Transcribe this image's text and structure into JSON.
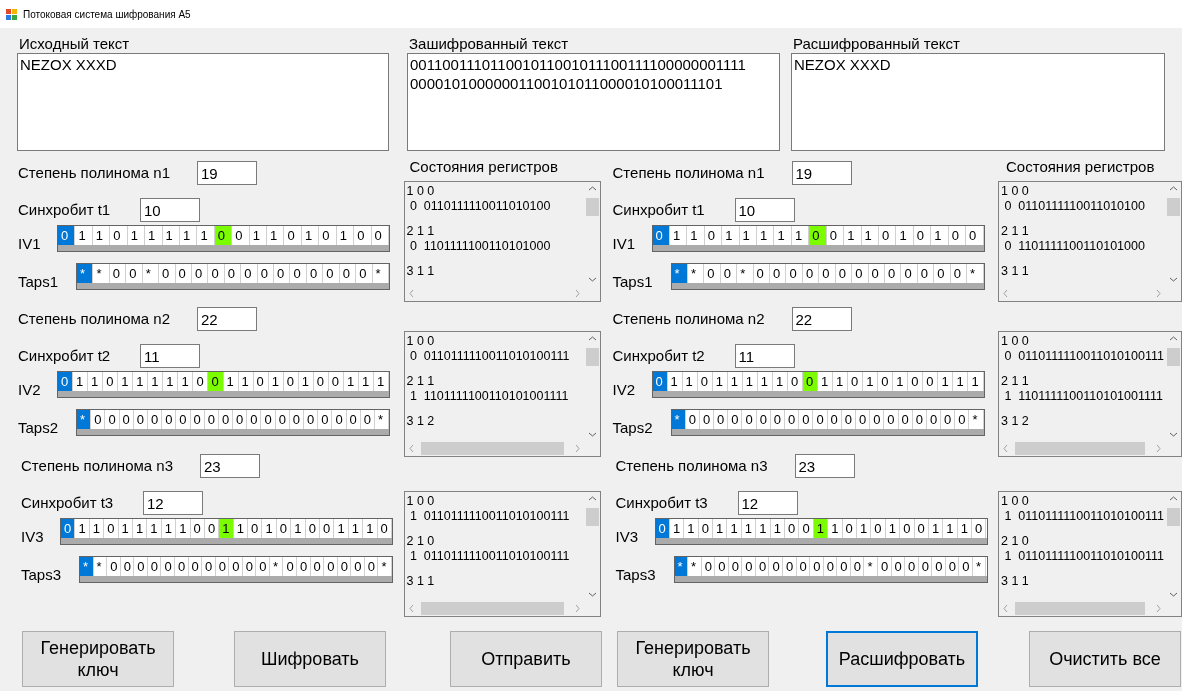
{
  "window": {
    "title": "Потоковая система шифрования А5"
  },
  "texts": [
    {
      "label": "Исходный текст",
      "lines": [
        "NEZOX XXXD"
      ]
    },
    {
      "label": "Зашифрованный текст",
      "lines": [
        "001100111011001011001011100111100000001111",
        "00001010000001100101011000010100011101"
      ]
    },
    {
      "label": "Расшифрованный текст",
      "lines": [
        "NEZOX XXXD"
      ]
    }
  ],
  "panels": [
    {
      "states_title": "Состояния регистров",
      "registers": [
        {
          "degree_label": "Степень полинома n1",
          "degree": "19",
          "sync_label": "Синхробит t1",
          "sync": "10",
          "iv": {
            "label": "IV1",
            "cells": [
              {
                "text": "0",
                "selected": true,
                "highlighted": false
              },
              {
                "text": "1",
                "selected": false,
                "highlighted": false
              },
              {
                "text": "1",
                "selected": false,
                "highlighted": false
              },
              {
                "text": "0",
                "selected": false,
                "highlighted": false
              },
              {
                "text": "1",
                "selected": false,
                "highlighted": false
              },
              {
                "text": "1",
                "selected": false,
                "highlighted": false
              },
              {
                "text": "1",
                "selected": false,
                "highlighted": false
              },
              {
                "text": "1",
                "selected": false,
                "highlighted": false
              },
              {
                "text": "1",
                "selected": false,
                "highlighted": false
              },
              {
                "text": "0",
                "selected": false,
                "highlighted": true
              },
              {
                "text": "0",
                "selected": false,
                "highlighted": false
              },
              {
                "text": "1",
                "selected": false,
                "highlighted": false
              },
              {
                "text": "1",
                "selected": false,
                "highlighted": false
              },
              {
                "text": "0",
                "selected": false,
                "highlighted": false
              },
              {
                "text": "1",
                "selected": false,
                "highlighted": false
              },
              {
                "text": "0",
                "selected": false,
                "highlighted": false
              },
              {
                "text": "1",
                "selected": false,
                "highlighted": false
              },
              {
                "text": "0",
                "selected": false,
                "highlighted": false
              },
              {
                "text": "0",
                "selected": false,
                "highlighted": false
              }
            ]
          },
          "taps": {
            "label": "Taps1",
            "cells": [
              {
                "text": "*",
                "selected": true,
                "highlighted": false
              },
              {
                "text": "*",
                "selected": false,
                "highlighted": false
              },
              {
                "text": "0",
                "selected": false,
                "highlighted": false
              },
              {
                "text": "0",
                "selected": false,
                "highlighted": false
              },
              {
                "text": "*",
                "selected": false,
                "highlighted": false
              },
              {
                "text": "0",
                "selected": false,
                "highlighted": false
              },
              {
                "text": "0",
                "selected": false,
                "highlighted": false
              },
              {
                "text": "0",
                "selected": false,
                "highlighted": false
              },
              {
                "text": "0",
                "selected": false,
                "highlighted": false
              },
              {
                "text": "0",
                "selected": false,
                "highlighted": false
              },
              {
                "text": "0",
                "selected": false,
                "highlighted": false
              },
              {
                "text": "0",
                "selected": false,
                "highlighted": false
              },
              {
                "text": "0",
                "selected": false,
                "highlighted": false
              },
              {
                "text": "0",
                "selected": false,
                "highlighted": false
              },
              {
                "text": "0",
                "selected": false,
                "highlighted": false
              },
              {
                "text": "0",
                "selected": false,
                "highlighted": false
              },
              {
                "text": "0",
                "selected": false,
                "highlighted": false
              },
              {
                "text": "0",
                "selected": false,
                "highlighted": false
              },
              {
                "text": "*",
                "selected": false,
                "highlighted": false
              }
            ]
          },
          "log": [
            {
              "header": "1 0 0",
              "state": "0  0110111110011010100"
            },
            {
              "header": "2 1 1",
              "state": "0  1101111100110101000"
            },
            {
              "header": "3 1 1"
            }
          ]
        },
        {
          "degree_label": "Степень полинома n2",
          "degree": "22",
          "sync_label": "Синхробит t2",
          "sync": "11",
          "iv": {
            "label": "IV2",
            "cells": [
              {
                "text": "0",
                "selected": true,
                "highlighted": false
              },
              {
                "text": "1",
                "selected": false,
                "highlighted": false
              },
              {
                "text": "1",
                "selected": false,
                "highlighted": false
              },
              {
                "text": "0",
                "selected": false,
                "highlighted": false
              },
              {
                "text": "1",
                "selected": false,
                "highlighted": false
              },
              {
                "text": "1",
                "selected": false,
                "highlighted": false
              },
              {
                "text": "1",
                "selected": false,
                "highlighted": false
              },
              {
                "text": "1",
                "selected": false,
                "highlighted": false
              },
              {
                "text": "1",
                "selected": false,
                "highlighted": false
              },
              {
                "text": "0",
                "selected": false,
                "highlighted": false
              },
              {
                "text": "0",
                "selected": false,
                "highlighted": true
              },
              {
                "text": "1",
                "selected": false,
                "highlighted": false
              },
              {
                "text": "1",
                "selected": false,
                "highlighted": false
              },
              {
                "text": "0",
                "selected": false,
                "highlighted": false
              },
              {
                "text": "1",
                "selected": false,
                "highlighted": false
              },
              {
                "text": "0",
                "selected": false,
                "highlighted": false
              },
              {
                "text": "1",
                "selected": false,
                "highlighted": false
              },
              {
                "text": "0",
                "selected": false,
                "highlighted": false
              },
              {
                "text": "0",
                "selected": false,
                "highlighted": false
              },
              {
                "text": "1",
                "selected": false,
                "highlighted": false
              },
              {
                "text": "1",
                "selected": false,
                "highlighted": false
              },
              {
                "text": "1",
                "selected": false,
                "highlighted": false
              }
            ]
          },
          "taps": {
            "label": "Taps2",
            "cells": [
              {
                "text": "*",
                "selected": true,
                "highlighted": false
              },
              {
                "text": "0",
                "selected": false,
                "highlighted": false
              },
              {
                "text": "0",
                "selected": false,
                "highlighted": false
              },
              {
                "text": "0",
                "selected": false,
                "highlighted": false
              },
              {
                "text": "0",
                "selected": false,
                "highlighted": false
              },
              {
                "text": "0",
                "selected": false,
                "highlighted": false
              },
              {
                "text": "0",
                "selected": false,
                "highlighted": false
              },
              {
                "text": "0",
                "selected": false,
                "highlighted": false
              },
              {
                "text": "0",
                "selected": false,
                "highlighted": false
              },
              {
                "text": "0",
                "selected": false,
                "highlighted": false
              },
              {
                "text": "0",
                "selected": false,
                "highlighted": false
              },
              {
                "text": "0",
                "selected": false,
                "highlighted": false
              },
              {
                "text": "0",
                "selected": false,
                "highlighted": false
              },
              {
                "text": "0",
                "selected": false,
                "highlighted": false
              },
              {
                "text": "0",
                "selected": false,
                "highlighted": false
              },
              {
                "text": "0",
                "selected": false,
                "highlighted": false
              },
              {
                "text": "0",
                "selected": false,
                "highlighted": false
              },
              {
                "text": "0",
                "selected": false,
                "highlighted": false
              },
              {
                "text": "0",
                "selected": false,
                "highlighted": false
              },
              {
                "text": "0",
                "selected": false,
                "highlighted": false
              },
              {
                "text": "0",
                "selected": false,
                "highlighted": false
              },
              {
                "text": "*",
                "selected": false,
                "highlighted": false
              }
            ]
          },
          "log": [
            {
              "header": "1 0 0",
              "state": "0  0110111110011010100111"
            },
            {
              "header": "2 1 1",
              "state": "1  1101111100110101001111"
            },
            {
              "header": "3 1 2"
            }
          ]
        },
        {
          "degree_label": "Степень полинома n3",
          "degree": "23",
          "sync_label": "Синхробит t3",
          "sync": "12",
          "iv": {
            "label": "IV3",
            "cells": [
              {
                "text": "0",
                "selected": true,
                "highlighted": false
              },
              {
                "text": "1",
                "selected": false,
                "highlighted": false
              },
              {
                "text": "1",
                "selected": false,
                "highlighted": false
              },
              {
                "text": "0",
                "selected": false,
                "highlighted": false
              },
              {
                "text": "1",
                "selected": false,
                "highlighted": false
              },
              {
                "text": "1",
                "selected": false,
                "highlighted": false
              },
              {
                "text": "1",
                "selected": false,
                "highlighted": false
              },
              {
                "text": "1",
                "selected": false,
                "highlighted": false
              },
              {
                "text": "1",
                "selected": false,
                "highlighted": false
              },
              {
                "text": "0",
                "selected": false,
                "highlighted": false
              },
              {
                "text": "0",
                "selected": false,
                "highlighted": false
              },
              {
                "text": "1",
                "selected": false,
                "highlighted": true
              },
              {
                "text": "1",
                "selected": false,
                "highlighted": false
              },
              {
                "text": "0",
                "selected": false,
                "highlighted": false
              },
              {
                "text": "1",
                "selected": false,
                "highlighted": false
              },
              {
                "text": "0",
                "selected": false,
                "highlighted": false
              },
              {
                "text": "1",
                "selected": false,
                "highlighted": false
              },
              {
                "text": "0",
                "selected": false,
                "highlighted": false
              },
              {
                "text": "0",
                "selected": false,
                "highlighted": false
              },
              {
                "text": "1",
                "selected": false,
                "highlighted": false
              },
              {
                "text": "1",
                "selected": false,
                "highlighted": false
              },
              {
                "text": "1",
                "selected": false,
                "highlighted": false
              },
              {
                "text": "0",
                "selected": false,
                "highlighted": false
              }
            ]
          },
          "taps": {
            "label": "Taps3",
            "cells": [
              {
                "text": "*",
                "selected": true,
                "highlighted": false
              },
              {
                "text": "*",
                "selected": false,
                "highlighted": false
              },
              {
                "text": "0",
                "selected": false,
                "highlighted": false
              },
              {
                "text": "0",
                "selected": false,
                "highlighted": false
              },
              {
                "text": "0",
                "selected": false,
                "highlighted": false
              },
              {
                "text": "0",
                "selected": false,
                "highlighted": false
              },
              {
                "text": "0",
                "selected": false,
                "highlighted": false
              },
              {
                "text": "0",
                "selected": false,
                "highlighted": false
              },
              {
                "text": "0",
                "selected": false,
                "highlighted": false
              },
              {
                "text": "0",
                "selected": false,
                "highlighted": false
              },
              {
                "text": "0",
                "selected": false,
                "highlighted": false
              },
              {
                "text": "0",
                "selected": false,
                "highlighted": false
              },
              {
                "text": "0",
                "selected": false,
                "highlighted": false
              },
              {
                "text": "0",
                "selected": false,
                "highlighted": false
              },
              {
                "text": "*",
                "selected": false,
                "highlighted": false
              },
              {
                "text": "0",
                "selected": false,
                "highlighted": false
              },
              {
                "text": "0",
                "selected": false,
                "highlighted": false
              },
              {
                "text": "0",
                "selected": false,
                "highlighted": false
              },
              {
                "text": "0",
                "selected": false,
                "highlighted": false
              },
              {
                "text": "0",
                "selected": false,
                "highlighted": false
              },
              {
                "text": "0",
                "selected": false,
                "highlighted": false
              },
              {
                "text": "0",
                "selected": false,
                "highlighted": false
              },
              {
                "text": "*",
                "selected": false,
                "highlighted": false
              }
            ]
          },
          "log": [
            {
              "header": "1 0 0",
              "state": "1  0110111110011010100111"
            },
            {
              "header": "2 1 0",
              "state": "1  0110111110011010100111"
            },
            {
              "header": "3 1 1"
            }
          ]
        }
      ]
    },
    {
      "states_title": "Состояния регистров",
      "registers": [
        {
          "degree_label": "Степень полинома n1",
          "degree": "19",
          "sync_label": "Синхробит t1",
          "sync": "10",
          "iv": {
            "label": "IV1",
            "cells": [
              {
                "text": "0",
                "selected": true,
                "highlighted": false
              },
              {
                "text": "1",
                "selected": false,
                "highlighted": false
              },
              {
                "text": "1",
                "selected": false,
                "highlighted": false
              },
              {
                "text": "0",
                "selected": false,
                "highlighted": false
              },
              {
                "text": "1",
                "selected": false,
                "highlighted": false
              },
              {
                "text": "1",
                "selected": false,
                "highlighted": false
              },
              {
                "text": "1",
                "selected": false,
                "highlighted": false
              },
              {
                "text": "1",
                "selected": false,
                "highlighted": false
              },
              {
                "text": "1",
                "selected": false,
                "highlighted": false
              },
              {
                "text": "0",
                "selected": false,
                "highlighted": true
              },
              {
                "text": "0",
                "selected": false,
                "highlighted": false
              },
              {
                "text": "1",
                "selected": false,
                "highlighted": false
              },
              {
                "text": "1",
                "selected": false,
                "highlighted": false
              },
              {
                "text": "0",
                "selected": false,
                "highlighted": false
              },
              {
                "text": "1",
                "selected": false,
                "highlighted": false
              },
              {
                "text": "0",
                "selected": false,
                "highlighted": false
              },
              {
                "text": "1",
                "selected": false,
                "highlighted": false
              },
              {
                "text": "0",
                "selected": false,
                "highlighted": false
              },
              {
                "text": "0",
                "selected": false,
                "highlighted": false
              }
            ]
          },
          "taps": {
            "label": "Taps1",
            "cells": [
              {
                "text": "*",
                "selected": true,
                "highlighted": false
              },
              {
                "text": "*",
                "selected": false,
                "highlighted": false
              },
              {
                "text": "0",
                "selected": false,
                "highlighted": false
              },
              {
                "text": "0",
                "selected": false,
                "highlighted": false
              },
              {
                "text": "*",
                "selected": false,
                "highlighted": false
              },
              {
                "text": "0",
                "selected": false,
                "highlighted": false
              },
              {
                "text": "0",
                "selected": false,
                "highlighted": false
              },
              {
                "text": "0",
                "selected": false,
                "highlighted": false
              },
              {
                "text": "0",
                "selected": false,
                "highlighted": false
              },
              {
                "text": "0",
                "selected": false,
                "highlighted": false
              },
              {
                "text": "0",
                "selected": false,
                "highlighted": false
              },
              {
                "text": "0",
                "selected": false,
                "highlighted": false
              },
              {
                "text": "0",
                "selected": false,
                "highlighted": false
              },
              {
                "text": "0",
                "selected": false,
                "highlighted": false
              },
              {
                "text": "0",
                "selected": false,
                "highlighted": false
              },
              {
                "text": "0",
                "selected": false,
                "highlighted": false
              },
              {
                "text": "0",
                "selected": false,
                "highlighted": false
              },
              {
                "text": "0",
                "selected": false,
                "highlighted": false
              },
              {
                "text": "*",
                "selected": false,
                "highlighted": false
              }
            ]
          },
          "log": [
            {
              "header": "1 0 0",
              "state": "0  0110111110011010100"
            },
            {
              "header": "2 1 1",
              "state": "0  1101111100110101000"
            },
            {
              "header": "3 1 1"
            }
          ]
        },
        {
          "degree_label": "Степень полинома n2",
          "degree": "22",
          "sync_label": "Синхробит t2",
          "sync": "11",
          "iv": {
            "label": "IV2",
            "cells": [
              {
                "text": "0",
                "selected": true,
                "highlighted": false
              },
              {
                "text": "1",
                "selected": false,
                "highlighted": false
              },
              {
                "text": "1",
                "selected": false,
                "highlighted": false
              },
              {
                "text": "0",
                "selected": false,
                "highlighted": false
              },
              {
                "text": "1",
                "selected": false,
                "highlighted": false
              },
              {
                "text": "1",
                "selected": false,
                "highlighted": false
              },
              {
                "text": "1",
                "selected": false,
                "highlighted": false
              },
              {
                "text": "1",
                "selected": false,
                "highlighted": false
              },
              {
                "text": "1",
                "selected": false,
                "highlighted": false
              },
              {
                "text": "0",
                "selected": false,
                "highlighted": false
              },
              {
                "text": "0",
                "selected": false,
                "highlighted": true
              },
              {
                "text": "1",
                "selected": false,
                "highlighted": false
              },
              {
                "text": "1",
                "selected": false,
                "highlighted": false
              },
              {
                "text": "0",
                "selected": false,
                "highlighted": false
              },
              {
                "text": "1",
                "selected": false,
                "highlighted": false
              },
              {
                "text": "0",
                "selected": false,
                "highlighted": false
              },
              {
                "text": "1",
                "selected": false,
                "highlighted": false
              },
              {
                "text": "0",
                "selected": false,
                "highlighted": false
              },
              {
                "text": "0",
                "selected": false,
                "highlighted": false
              },
              {
                "text": "1",
                "selected": false,
                "highlighted": false
              },
              {
                "text": "1",
                "selected": false,
                "highlighted": false
              },
              {
                "text": "1",
                "selected": false,
                "highlighted": false
              }
            ]
          },
          "taps": {
            "label": "Taps2",
            "cells": [
              {
                "text": "*",
                "selected": true,
                "highlighted": false
              },
              {
                "text": "0",
                "selected": false,
                "highlighted": false
              },
              {
                "text": "0",
                "selected": false,
                "highlighted": false
              },
              {
                "text": "0",
                "selected": false,
                "highlighted": false
              },
              {
                "text": "0",
                "selected": false,
                "highlighted": false
              },
              {
                "text": "0",
                "selected": false,
                "highlighted": false
              },
              {
                "text": "0",
                "selected": false,
                "highlighted": false
              },
              {
                "text": "0",
                "selected": false,
                "highlighted": false
              },
              {
                "text": "0",
                "selected": false,
                "highlighted": false
              },
              {
                "text": "0",
                "selected": false,
                "highlighted": false
              },
              {
                "text": "0",
                "selected": false,
                "highlighted": false
              },
              {
                "text": "0",
                "selected": false,
                "highlighted": false
              },
              {
                "text": "0",
                "selected": false,
                "highlighted": false
              },
              {
                "text": "0",
                "selected": false,
                "highlighted": false
              },
              {
                "text": "0",
                "selected": false,
                "highlighted": false
              },
              {
                "text": "0",
                "selected": false,
                "highlighted": false
              },
              {
                "text": "0",
                "selected": false,
                "highlighted": false
              },
              {
                "text": "0",
                "selected": false,
                "highlighted": false
              },
              {
                "text": "0",
                "selected": false,
                "highlighted": false
              },
              {
                "text": "0",
                "selected": false,
                "highlighted": false
              },
              {
                "text": "0",
                "selected": false,
                "highlighted": false
              },
              {
                "text": "*",
                "selected": false,
                "highlighted": false
              }
            ]
          },
          "log": [
            {
              "header": "1 0 0",
              "state": "0  0110111110011010100111"
            },
            {
              "header": "2 1 1",
              "state": "1  1101111100110101001111"
            },
            {
              "header": "3 1 2"
            }
          ]
        },
        {
          "degree_label": "Степень полинома n3",
          "degree": "23",
          "sync_label": "Синхробит t3",
          "sync": "12",
          "iv": {
            "label": "IV3",
            "cells": [
              {
                "text": "0",
                "selected": true,
                "highlighted": false
              },
              {
                "text": "1",
                "selected": false,
                "highlighted": false
              },
              {
                "text": "1",
                "selected": false,
                "highlighted": false
              },
              {
                "text": "0",
                "selected": false,
                "highlighted": false
              },
              {
                "text": "1",
                "selected": false,
                "highlighted": false
              },
              {
                "text": "1",
                "selected": false,
                "highlighted": false
              },
              {
                "text": "1",
                "selected": false,
                "highlighted": false
              },
              {
                "text": "1",
                "selected": false,
                "highlighted": false
              },
              {
                "text": "1",
                "selected": false,
                "highlighted": false
              },
              {
                "text": "0",
                "selected": false,
                "highlighted": false
              },
              {
                "text": "0",
                "selected": false,
                "highlighted": false
              },
              {
                "text": "1",
                "selected": false,
                "highlighted": true
              },
              {
                "text": "1",
                "selected": false,
                "highlighted": false
              },
              {
                "text": "0",
                "selected": false,
                "highlighted": false
              },
              {
                "text": "1",
                "selected": false,
                "highlighted": false
              },
              {
                "text": "0",
                "selected": false,
                "highlighted": false
              },
              {
                "text": "1",
                "selected": false,
                "highlighted": false
              },
              {
                "text": "0",
                "selected": false,
                "highlighted": false
              },
              {
                "text": "0",
                "selected": false,
                "highlighted": false
              },
              {
                "text": "1",
                "selected": false,
                "highlighted": false
              },
              {
                "text": "1",
                "selected": false,
                "highlighted": false
              },
              {
                "text": "1",
                "selected": false,
                "highlighted": false
              },
              {
                "text": "0",
                "selected": false,
                "highlighted": false
              }
            ]
          },
          "taps": {
            "label": "Taps3",
            "cells": [
              {
                "text": "*",
                "selected": true,
                "highlighted": false
              },
              {
                "text": "*",
                "selected": false,
                "highlighted": false
              },
              {
                "text": "0",
                "selected": false,
                "highlighted": false
              },
              {
                "text": "0",
                "selected": false,
                "highlighted": false
              },
              {
                "text": "0",
                "selected": false,
                "highlighted": false
              },
              {
                "text": "0",
                "selected": false,
                "highlighted": false
              },
              {
                "text": "0",
                "selected": false,
                "highlighted": false
              },
              {
                "text": "0",
                "selected": false,
                "highlighted": false
              },
              {
                "text": "0",
                "selected": false,
                "highlighted": false
              },
              {
                "text": "0",
                "selected": false,
                "highlighted": false
              },
              {
                "text": "0",
                "selected": false,
                "highlighted": false
              },
              {
                "text": "0",
                "selected": false,
                "highlighted": false
              },
              {
                "text": "0",
                "selected": false,
                "highlighted": false
              },
              {
                "text": "0",
                "selected": false,
                "highlighted": false
              },
              {
                "text": "*",
                "selected": false,
                "highlighted": false
              },
              {
                "text": "0",
                "selected": false,
                "highlighted": false
              },
              {
                "text": "0",
                "selected": false,
                "highlighted": false
              },
              {
                "text": "0",
                "selected": false,
                "highlighted": false
              },
              {
                "text": "0",
                "selected": false,
                "highlighted": false
              },
              {
                "text": "0",
                "selected": false,
                "highlighted": false
              },
              {
                "text": "0",
                "selected": false,
                "highlighted": false
              },
              {
                "text": "0",
                "selected": false,
                "highlighted": false
              },
              {
                "text": "*",
                "selected": false,
                "highlighted": false
              }
            ]
          },
          "log": [
            {
              "header": "1 0 0",
              "state": "1  0110111110011010100111"
            },
            {
              "header": "2 1 0",
              "state": "1  0110111110011010100111"
            },
            {
              "header": "3 1 1"
            }
          ]
        }
      ]
    }
  ],
  "buttons": [
    {
      "label": "Генерировать ключ",
      "focused": false
    },
    {
      "label": "Шифровать",
      "focused": false
    },
    {
      "label": "Отправить",
      "focused": false
    },
    {
      "label": "Генерировать ключ",
      "focused": false
    },
    {
      "label": "Расшифровать",
      "focused": true
    },
    {
      "label": "Очистить все",
      "focused": false
    }
  ]
}
